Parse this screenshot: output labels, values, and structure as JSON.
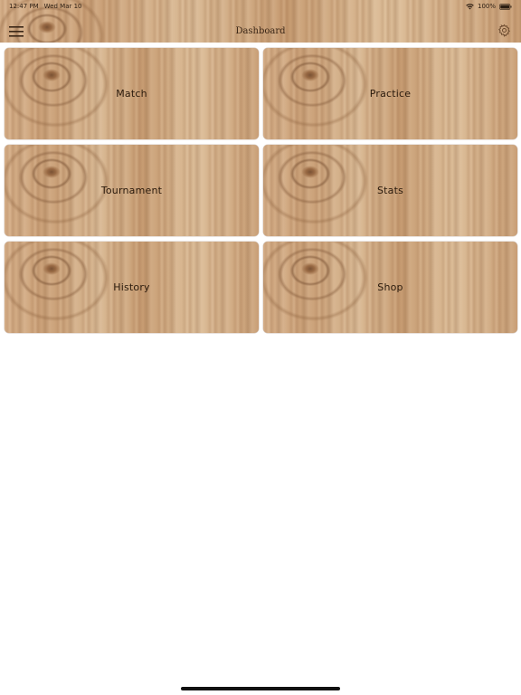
{
  "status_bar": {
    "time": "12:47 PM",
    "date": "Wed Mar 10",
    "battery": "100%",
    "wifi_icon": "wifi-icon",
    "battery_icon": "battery-icon"
  },
  "header": {
    "title": "Dashboard",
    "menu_icon": "hamburger-menu-icon",
    "settings_icon": "gear-icon"
  },
  "tiles": [
    {
      "label": "Match"
    },
    {
      "label": "Practice"
    },
    {
      "label": "Tournament"
    },
    {
      "label": "Stats"
    },
    {
      "label": "History"
    },
    {
      "label": "Shop"
    }
  ],
  "colors": {
    "wood_base": "#c9a27a",
    "label_text": "#2a1a0c",
    "background": "#ffffff"
  }
}
